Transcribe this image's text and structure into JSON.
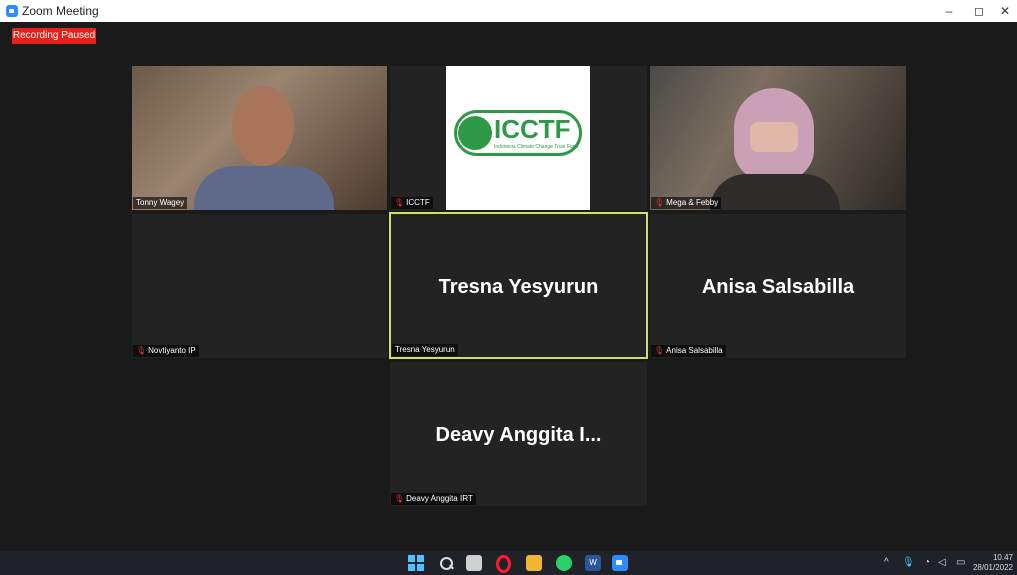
{
  "window": {
    "title": "Zoom Meeting",
    "minimize": "–",
    "restore": "◻",
    "close": "✕"
  },
  "recording": {
    "label": "Recording Paused"
  },
  "participants": [
    {
      "name": "Tonny Wagey",
      "muted": false
    },
    {
      "name": "ICCTF",
      "muted": true,
      "logo_text": "ICCTF",
      "logo_subtext": "Indonesia Climate Change Trust Fund"
    },
    {
      "name": "Mega & Febby",
      "muted": true
    },
    {
      "name": "Novtiyanto IP",
      "muted": true
    },
    {
      "name": "Tresna Yesyurun",
      "muted": false,
      "display_name": "Tresna Yesyurun",
      "active_speaker": true
    },
    {
      "name": "Anisa Salsabilla",
      "muted": true,
      "display_name": "Anisa Salsabilla"
    },
    {
      "name": "Deavy Anggita IRT",
      "muted": true,
      "display_name": "Deavy Anggita I..."
    }
  ],
  "colors": {
    "active_speaker_border": "#c8e26a",
    "mute_icon": "#e03030",
    "recording_badge": "#e8201c"
  },
  "taskbar": {
    "icons": [
      "windows-start-icon",
      "search-icon",
      "task-view-icon",
      "opera-icon",
      "file-explorer-icon",
      "whatsapp-icon",
      "word-icon",
      "zoom-icon"
    ],
    "clock_time": "10.47",
    "clock_date": "28/01/2022"
  }
}
